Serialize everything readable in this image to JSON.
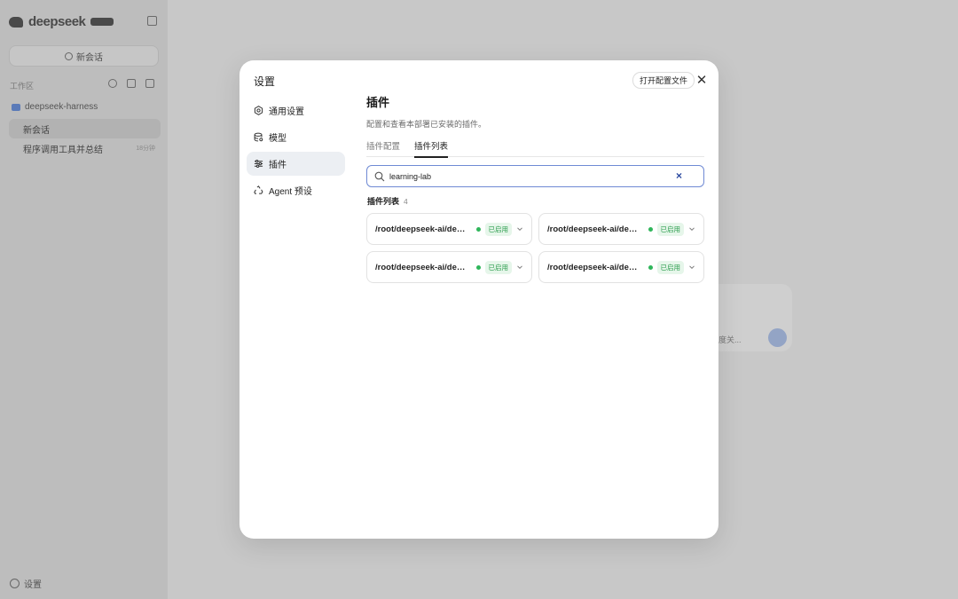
{
  "background": {
    "logo_text": "deepseek",
    "new_chat_label": "新会话",
    "workspace_label": "工作区",
    "project_name": "deepseek-harness",
    "chats": [
      {
        "title": "新会话",
        "time": ""
      },
      {
        "title": "程序调用工具并总结",
        "time": "18分钟"
      }
    ],
    "settings_label": "设置",
    "input_model_text": "度关..."
  },
  "modal": {
    "title": "设置",
    "open_config_label": "打开配置文件",
    "close_symbol": "✕",
    "nav": [
      {
        "label": "通用设置",
        "icon": "gear-icon"
      },
      {
        "label": "模型",
        "icon": "database-icon"
      },
      {
        "label": "插件",
        "icon": "sliders-icon"
      },
      {
        "label": "Agent 预设",
        "icon": "recycle-icon"
      }
    ],
    "active_nav": "插件",
    "content": {
      "title": "插件",
      "description": "配置和查看本部署已安装的插件。",
      "tabs": [
        {
          "label": "插件配置",
          "active": false
        },
        {
          "label": "插件列表",
          "active": true
        }
      ],
      "search": {
        "value": "learning-lab",
        "placeholder": "",
        "clear_symbol": "×"
      },
      "list_title": "插件列表",
      "list_count": "4",
      "plugins": [
        {
          "name": "/root/deepseek-ai/deepseek-harness/plugins/learning-lab",
          "status": "已启用"
        },
        {
          "name": "/root/deepseek-ai/deepseek-harness/plugins/learning-lab",
          "status": "已启用"
        },
        {
          "name": "/root/deepseek-ai/deepseek-harness/plugins/learning-lab",
          "status": "已启用"
        },
        {
          "name": "/root/deepseek-ai/deepseek-harness/plugins/learning-lab",
          "status": "已启用"
        }
      ]
    }
  },
  "colors": {
    "accent": "#6f8ad4",
    "enabled_green": "#2fb65a",
    "overlay": "#c9c9c9"
  }
}
